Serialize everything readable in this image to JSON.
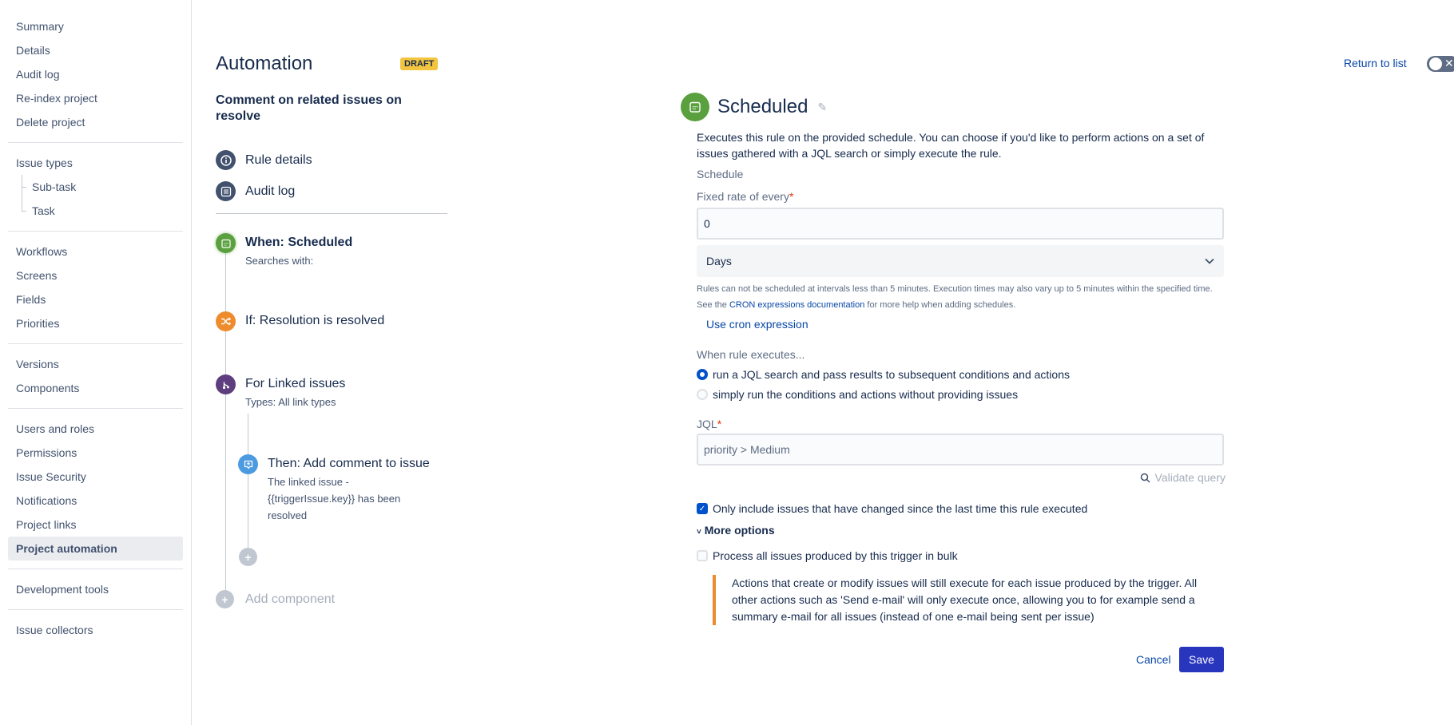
{
  "sidebar": {
    "groups": [
      [
        "Summary",
        "Details",
        "Audit log",
        "Re-index project",
        "Delete project"
      ],
      [
        "Issue types",
        "Sub-task",
        "Task"
      ],
      [
        "Workflows",
        "Screens",
        "Fields",
        "Priorities"
      ],
      [
        "Versions",
        "Components"
      ],
      [
        "Users and roles",
        "Permissions",
        "Issue Security",
        "Notifications",
        "Project links",
        "Project automation"
      ],
      [
        "Development tools"
      ],
      [
        "Issue collectors"
      ]
    ],
    "active": "Project automation"
  },
  "rule_panel": {
    "title": "Automation",
    "badge": "DRAFT",
    "rule_name": "Comment on related issues on resolve",
    "links": [
      {
        "label": "Rule details",
        "icon": "info-icon"
      },
      {
        "label": "Audit log",
        "icon": "list-icon"
      }
    ],
    "steps": [
      {
        "title": "When: Scheduled",
        "sub": "Searches with:",
        "icon": "calendar-icon",
        "color": "#5aa03e"
      },
      {
        "title": "If: Resolution is resolved",
        "sub": "",
        "icon": "shuffle-icon",
        "color": "#ee8b2c"
      },
      {
        "title": "For Linked issues",
        "sub": "Types: All link types",
        "icon": "branch-icon",
        "color": "#5e3e7e"
      },
      {
        "title": "Then: Add comment to issue",
        "sub": "The linked issue - {{triggerIssue.key}} has been resolved",
        "icon": "comment-plus-icon",
        "color": "#4c9ae0"
      }
    ],
    "add_component": "Add component"
  },
  "header": {
    "return_link": "Return to list",
    "toggle_symbol": "✕"
  },
  "config": {
    "title": "Scheduled",
    "description": "Executes this rule on the provided schedule. You can choose if you'd like to perform actions on a set of issues gathered with a JQL search or simply execute the rule.",
    "schedule_label": "Schedule",
    "fixed_rate_label": "Fixed rate of every",
    "fixed_rate_value": "0",
    "unit_selected": "Days",
    "hint_line1": "Rules can not be scheduled at intervals less than 5 minutes. Execution times may also vary up to 5 minutes within the specified time.",
    "hint_see": "See the",
    "hint_link": "CRON expressions documentation",
    "hint_rest": "for more help when adding schedules.",
    "cron_link": "Use cron expression",
    "when_label": "When rule executes...",
    "radio_options": [
      {
        "label": "run a JQL search and pass results to subsequent conditions and actions",
        "selected": true
      },
      {
        "label": "simply run the conditions and actions without providing issues",
        "selected": false
      }
    ],
    "jql_label": "JQL",
    "jql_value": "priority > Medium",
    "validate_label": "Validate query",
    "only_changed_label": "Only include issues that have changed since the last time this rule executed",
    "only_changed_checked": true,
    "more_options": "More options",
    "bulk_label": "Process all issues produced by this trigger in bulk",
    "bulk_checked": false,
    "note": "Actions that create or modify issues will still execute for each issue produced by the trigger. All other actions such as 'Send e-mail' will only execute once, allowing you to for example send a summary e-mail for all issues (instead of one e-mail being sent per issue)",
    "cancel": "Cancel",
    "save": "Save"
  }
}
